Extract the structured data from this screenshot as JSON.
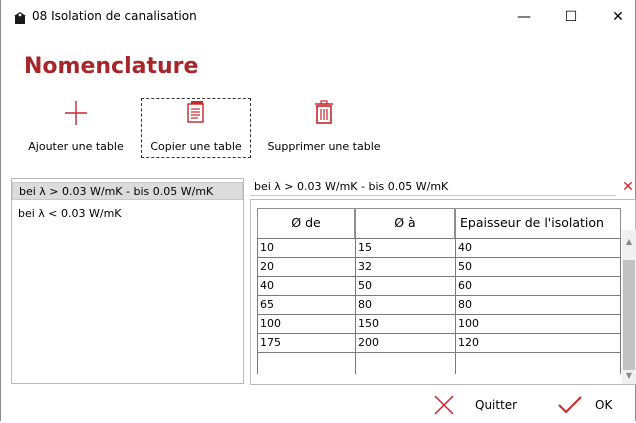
{
  "window": {
    "title": "08 Isolation de canalisation",
    "controls": {
      "minimize_glyph": "—",
      "maximize_glyph": "☐",
      "close_glyph": "✕"
    }
  },
  "heading": "Nomenclature",
  "colors": {
    "heading": "#a8262a",
    "delete": "#c8262a",
    "ok_check": "#c8262a",
    "add_plus": "#c8262a"
  },
  "toolbar": {
    "add_label": "Ajouter une table",
    "copy_label": "Copier une table",
    "delete_label": "Supprimer une table",
    "icons": {
      "add": "plus-icon",
      "copy": "copy-icon",
      "delete": "trash-icon"
    }
  },
  "tables": {
    "items": [
      {
        "label": "bei λ > 0.03 W/mK - bis  0.05 W/mK"
      },
      {
        "label": "bei λ < 0.03 W/mK"
      }
    ]
  },
  "editor": {
    "name_value": "bei λ > 0.03 W/mK - bis  0.05 W/mK",
    "delete_glyph": "✕",
    "columns": [
      "Ø de",
      "Ø à",
      "Epaisseur de l'isolation"
    ],
    "rows": [
      [
        "10",
        "15",
        "40"
      ],
      [
        "20",
        "32",
        "50"
      ],
      [
        "40",
        "50",
        "60"
      ],
      [
        "65",
        "80",
        "80"
      ],
      [
        "100",
        "150",
        "100"
      ],
      [
        "175",
        "200",
        "120"
      ],
      [
        "",
        "",
        ""
      ]
    ],
    "scroll": {
      "up_glyph": "▲",
      "down_glyph": "▼"
    }
  },
  "footer": {
    "quit_label": "Quitter",
    "ok_label": "OK",
    "icons": {
      "quit": "close-icon",
      "ok": "checkmark-icon"
    }
  }
}
